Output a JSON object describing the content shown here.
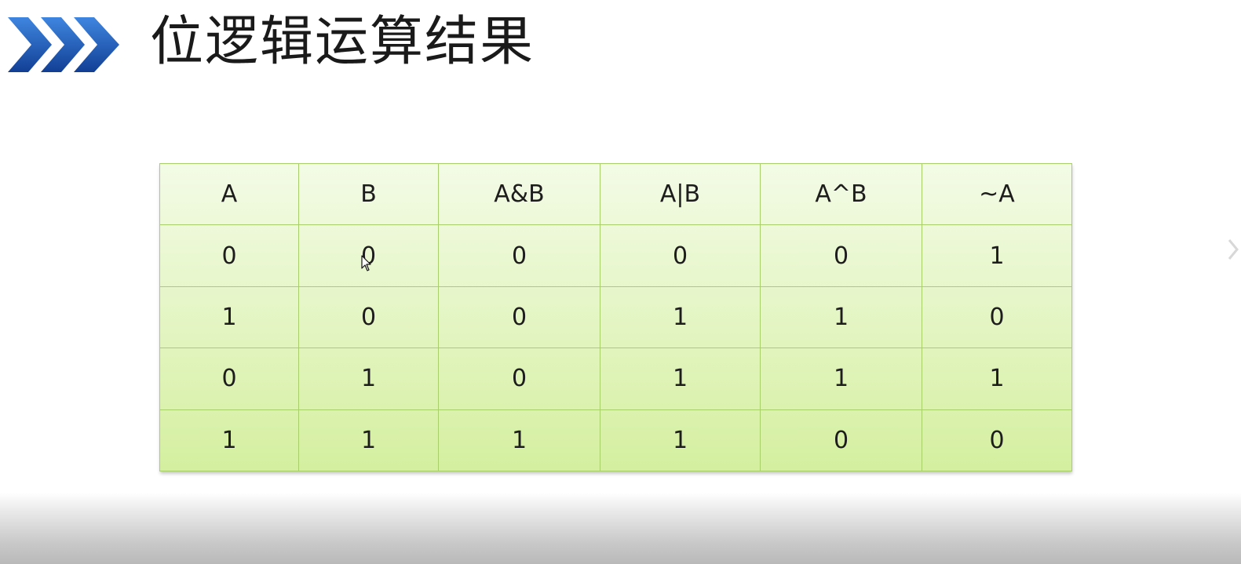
{
  "slide": {
    "title": "位逻辑运算结果",
    "accent_color": "#1f5bb5"
  },
  "table": {
    "headers": [
      "A",
      "B",
      "A&B",
      "A|B",
      "A^B",
      "~A"
    ],
    "rows": [
      [
        "0",
        "0",
        "0",
        "0",
        "0",
        "1"
      ],
      [
        "1",
        "0",
        "0",
        "1",
        "1",
        "0"
      ],
      [
        "0",
        "1",
        "0",
        "1",
        "1",
        "1"
      ],
      [
        "1",
        "1",
        "1",
        "1",
        "0",
        "0"
      ]
    ],
    "fill_color_top": "#f3fbe6",
    "fill_color_bottom": "#d4ef9f",
    "border_color": "#a8cf6a"
  },
  "icons": {
    "title_decoration": "triple-chevron-right-icon",
    "pointer": "mouse-cursor-icon",
    "next": "chevron-right-icon"
  }
}
